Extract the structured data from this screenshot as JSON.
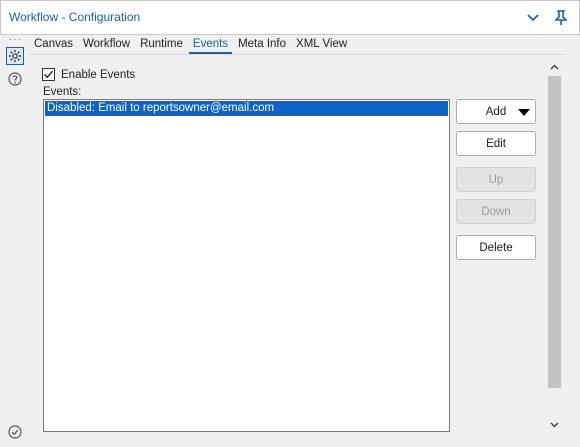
{
  "window": {
    "title": "Workflow - Configuration"
  },
  "icons": {
    "collapse": "chevron-down-icon",
    "pin": "pin-icon",
    "settings": "gear-icon",
    "help": "help-icon",
    "status": "check-circle-icon"
  },
  "tabs": [
    {
      "label": "Canvas",
      "active": false
    },
    {
      "label": "Workflow",
      "active": false
    },
    {
      "label": "Runtime",
      "active": false
    },
    {
      "label": "Events",
      "active": true
    },
    {
      "label": "Meta Info",
      "active": false
    },
    {
      "label": "XML View",
      "active": false
    }
  ],
  "events": {
    "enable_label": "Enable Events",
    "enable_checked": true,
    "list_label": "Events:",
    "items": [
      {
        "text": "Disabled: Email to reportsowner@email.com",
        "selected": true
      }
    ]
  },
  "buttons": {
    "add": "Add",
    "edit": "Edit",
    "up": "Up",
    "down": "Down",
    "delete": "Delete"
  },
  "colors": {
    "accent": "#1a63a6",
    "selection": "#0a64c8"
  }
}
